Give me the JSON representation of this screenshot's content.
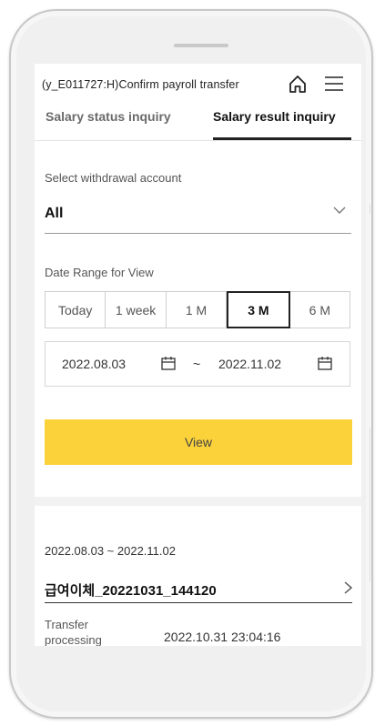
{
  "header": {
    "title": "(y_E011727:H)Confirm  payroll transfer",
    "home_icon": "home-icon",
    "menu_icon": "hamburger-menu-icon"
  },
  "tabs": [
    {
      "label": "Salary status inquiry",
      "active": false
    },
    {
      "label": "Salary result inquiry",
      "active": true
    }
  ],
  "account": {
    "label": "Select withdrawal account",
    "value": "All"
  },
  "period": {
    "label": "Date Range for View",
    "options": [
      "Today",
      "1 week",
      "1 M",
      "3 M",
      "6 M"
    ],
    "selected": "3 M",
    "start_date": "2022.08.03",
    "separator": "~",
    "end_date": "2022.11.02"
  },
  "view_button": {
    "label": "View"
  },
  "result": {
    "range": "2022.08.03 ~ 2022.11.02",
    "name": "급여이체_20221031_144120",
    "processing_label": "Transfer processing date",
    "processing_value": "2022.10.31 23:04:16"
  },
  "colors": {
    "accent_yellow": "#fbd23a",
    "frame": "#f0f0f0"
  }
}
